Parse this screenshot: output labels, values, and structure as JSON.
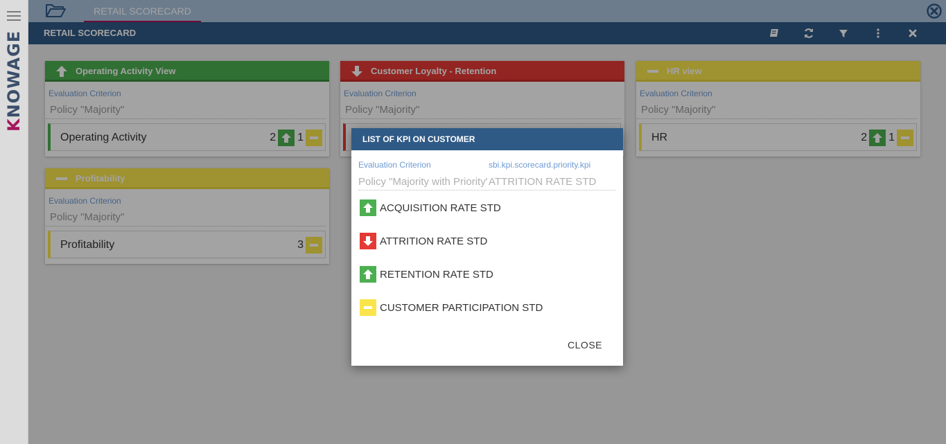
{
  "app": {
    "brand": "KNOWAGE",
    "tab_label": "RETAIL SCORECARD",
    "title": "RETAIL SCORECARD"
  },
  "colors": {
    "accent": "#a4155a",
    "header_blue": "#2f5a85",
    "status_green": "#4caf50",
    "status_red": "#e53935",
    "status_yellow": "#f9e54b"
  },
  "toolbar": {
    "icons": [
      "book-icon",
      "refresh-icon",
      "filter-icon",
      "more-vert-icon",
      "close-icon"
    ]
  },
  "cards": [
    {
      "title": "Operating Activity View",
      "status": "up",
      "criterion_label": "Evaluation Criterion",
      "criterion_value": "Policy \"Majority\"",
      "row": {
        "name": "Operating Activity",
        "counts": [
          {
            "n": "2",
            "status": "up"
          },
          {
            "n": "1",
            "status": "neutral"
          }
        ]
      }
    },
    {
      "title": "Customer Loyalty - Retention",
      "status": "down",
      "criterion_label": "Evaluation Criterion",
      "criterion_value": "Policy \"Majority\""
    },
    {
      "title": "HR view",
      "status": "neutral",
      "criterion_label": "Evaluation Criterion",
      "criterion_value": "Policy \"Majority\"",
      "row": {
        "name": "HR",
        "counts": [
          {
            "n": "2",
            "status": "up"
          },
          {
            "n": "1",
            "status": "neutral"
          }
        ]
      }
    },
    {
      "title": "Profitability",
      "status": "neutral",
      "criterion_label": "Evaluation Criterion",
      "criterion_value": "Policy \"Majority\"",
      "row": {
        "name": "Profitability",
        "counts": [
          {
            "n": "3",
            "status": "neutral"
          }
        ]
      }
    }
  ],
  "dialog": {
    "title": "LIST OF KPI ON CUSTOMER",
    "criterion_label": "Evaluation Criterion",
    "criterion_value": "Policy \"Majority with Priority\"",
    "priority_label": "sbi.kpi.scorecard.priority.kpi",
    "priority_value": "ATTRITION RATE STD",
    "kpis": [
      {
        "label": "ACQUISITION RATE STD",
        "status": "up"
      },
      {
        "label": "ATTRITION RATE STD",
        "status": "down"
      },
      {
        "label": "RETENTION RATE STD",
        "status": "up"
      },
      {
        "label": "CUSTOMER PARTICIPATION STD",
        "status": "neutral"
      }
    ],
    "close_label": "CLOSE"
  }
}
